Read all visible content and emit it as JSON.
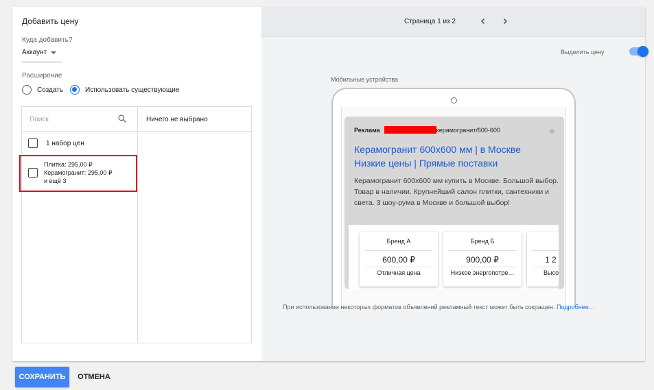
{
  "left_panel": {
    "title": "Добавить цену",
    "where_label": "Куда добавить?",
    "where_value": "Аккаунт",
    "extension_label": "Расширение",
    "radio_create": "Создать",
    "radio_existing": "Использовать существующие",
    "search_placeholder": "Поиск",
    "nothing_selected": "Ничего не выбрано",
    "items": [
      {
        "label": "1 набор цен"
      },
      {
        "line1": "Плитка: 295,00 ₽",
        "line2": "Керамогранит: 295,00 ₽",
        "line3": "и ещё 3"
      }
    ]
  },
  "right_panel": {
    "page_indicator": "Страница 1 из 2",
    "highlight_label": "Выделить цену",
    "device_label": "Мобильные устройства",
    "ad": {
      "ad_label": "Реклама",
      "url_suffix": "керамогранит/600-600",
      "headline": "Керамогранит 600х600 мм | в Москве Низкие цены | Прямые поставки",
      "description": "Керамогранит 600х600 мм купить в Москве. Большой выбор. Товар в наличии. Крупнейший салон плитки, сантехники и света. 3 шоу-рума в Москве и большой выбор!",
      "price_cards": [
        {
          "name": "Бренд А",
          "price": "600,00 ₽",
          "desc": "Отличная цена"
        },
        {
          "name": "Бренд Б",
          "price": "900,00 ₽",
          "desc": "Низкое энергопотре…"
        },
        {
          "name": "",
          "price": "1 2",
          "desc": "Высок"
        }
      ]
    },
    "footer_text": "При использовании некоторых форматов объявлений рекламный текст может быть сокращен.",
    "footer_link": "Подробнее…"
  },
  "buttons": {
    "save": "СОХРАНИТЬ",
    "cancel": "ОТМЕНА"
  },
  "colors": {
    "accent": "#1a73e8",
    "save_button": "#4285f4",
    "highlight_border": "#e0001b",
    "redaction": "#ff0000"
  }
}
